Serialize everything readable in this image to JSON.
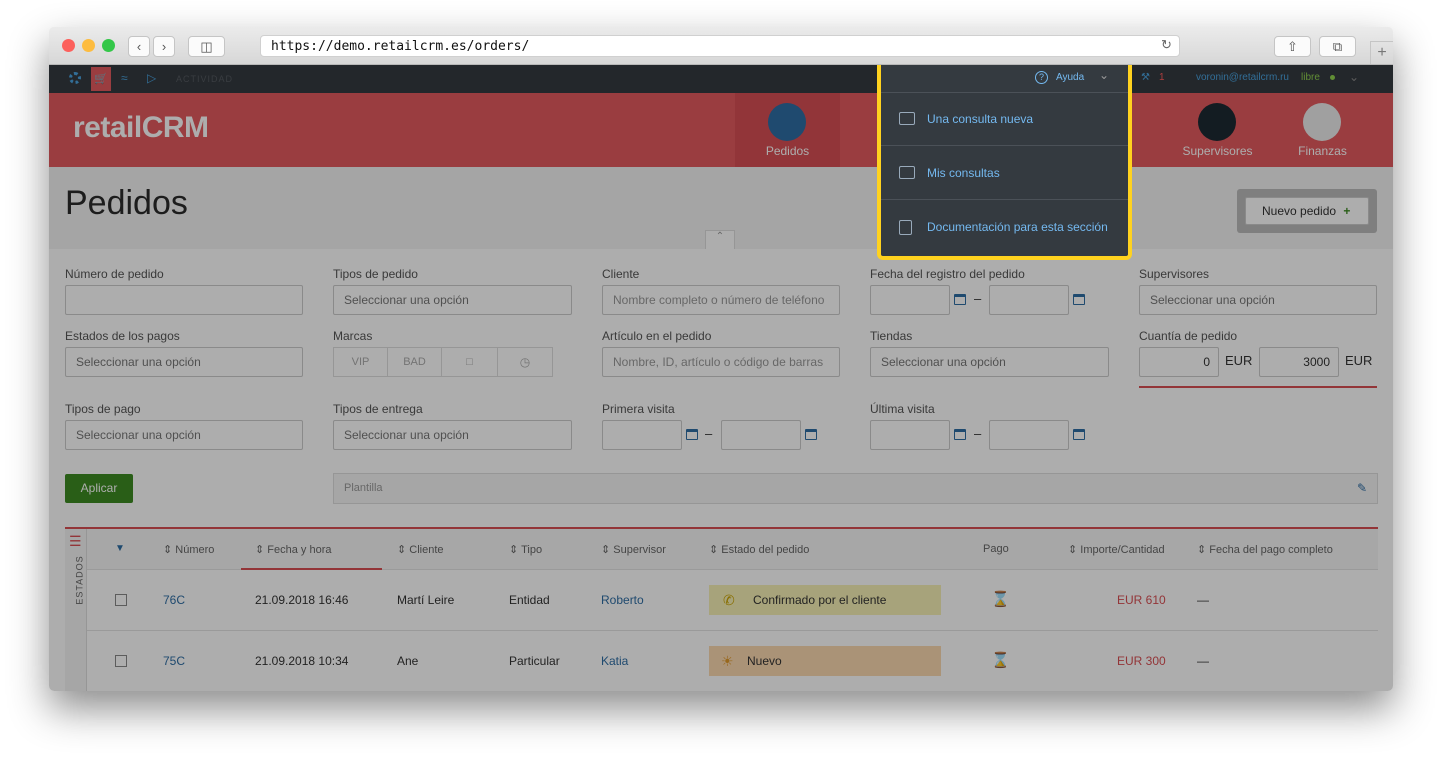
{
  "browser": {
    "url": "https://demo.retailcrm.es/orders/"
  },
  "topbar": {
    "activity": "ACTIVIDAD",
    "help": "Ayuda",
    "notif_count": "1",
    "user_email": "voronin@retailcrm.ru",
    "user_status": "libre"
  },
  "header": {
    "logo": "retailCRM",
    "nav": [
      {
        "label": "Pedidos"
      },
      {
        "label": "Supervisores"
      },
      {
        "label": "Finanzas"
      }
    ]
  },
  "page": {
    "title": "Pedidos",
    "new_order": "Nuevo pedido"
  },
  "help_menu": {
    "items": [
      {
        "label": "Una consulta nueva"
      },
      {
        "label": "Mis consultas"
      },
      {
        "label": "Documentación para esta sección"
      }
    ]
  },
  "filters": {
    "order_number": {
      "label": "Número de pedido",
      "value": ""
    },
    "order_types": {
      "label": "Tipos de pedido",
      "placeholder": "Seleccionar una opción"
    },
    "client": {
      "label": "Cliente",
      "placeholder": "Nombre completo o número de teléfono"
    },
    "reg_date": {
      "label": "Fecha del registro del pedido"
    },
    "supervisors": {
      "label": "Supervisores",
      "placeholder": "Seleccionar una opción"
    },
    "payment_states": {
      "label": "Estados de los pagos",
      "placeholder": "Seleccionar una opción"
    },
    "brands": {
      "label": "Marcas",
      "tags": [
        "VIP",
        "BAD"
      ]
    },
    "article": {
      "label": "Artículo en el pedido",
      "placeholder": "Nombre, ID, artículo o código de barras"
    },
    "stores": {
      "label": "Tiendas",
      "placeholder": "Seleccionar una opción"
    },
    "amount": {
      "label": "Cuantía de pedido",
      "min": "0",
      "max": "3000",
      "currency": "EUR"
    },
    "payment_types": {
      "label": "Tipos de pago",
      "placeholder": "Seleccionar una opción"
    },
    "delivery_types": {
      "label": "Tipos de entrega",
      "placeholder": "Seleccionar una opción"
    },
    "first_visit": {
      "label": "Primera visita"
    },
    "last_visit": {
      "label": "Última visita"
    },
    "apply": "Aplicar",
    "template": "Plantilla"
  },
  "table": {
    "states_label": "ESTADOS",
    "columns": [
      "Número",
      "Fecha y hora",
      "Cliente",
      "Tipo",
      "Supervisor",
      "Estado del pedido",
      "Pago",
      "Importe/Cantidad",
      "Fecha del pago completo"
    ],
    "rows": [
      {
        "number": "76C",
        "date": "21.09.2018 16:46",
        "client": "Martí Leire",
        "type": "Entidad",
        "supervisor": "Roberto",
        "status": "Confirmado por el cliente",
        "status_color": "#f7f1b5",
        "amount": "EUR 610",
        "paid_date": "—"
      },
      {
        "number": "75C",
        "date": "21.09.2018 10:34",
        "client": "Ane",
        "type": "Particular",
        "supervisor": "Katia",
        "status": "Nuevo",
        "status_color": "#fbd9b0",
        "amount": "EUR 300",
        "paid_date": "—"
      }
    ]
  },
  "colors": {
    "brand_red": "#e35b5f",
    "highlight": "#ffd21f",
    "apply_green": "#3d8b22",
    "link_blue": "#2a6ebb"
  }
}
